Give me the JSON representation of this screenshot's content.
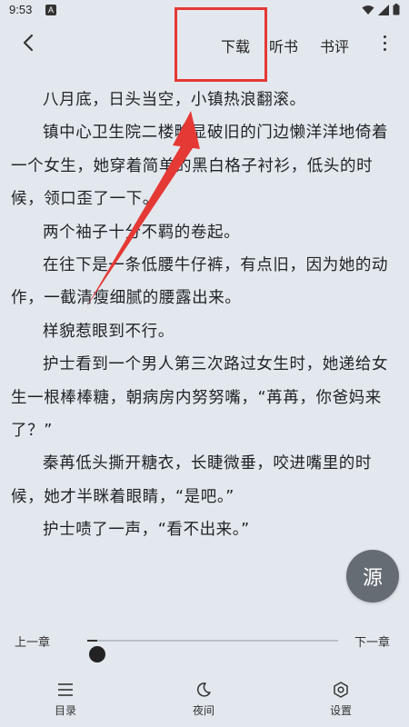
{
  "status_bar": {
    "time": "9:53",
    "indicator": "A"
  },
  "top_bar": {
    "back_icon": "chevron-left-icon",
    "tabs": [
      {
        "label": "下载"
      },
      {
        "label": "听书"
      },
      {
        "label": "书评"
      }
    ],
    "more_icon": "more-vertical-icon"
  },
  "reader": {
    "paragraphs": [
      "八月底，日头当空，小镇热浪翻滚。",
      "镇中心卫生院二楼略显破旧的门边懒洋洋地倚着一个女生，她穿着简单的黑白格子衬衫，低头的时候，领口歪了一下。",
      "两个袖子十分不羁的卷起。",
      "在往下是一条低腰牛仔裤，有点旧，因为她的动作，一截清瘦细腻的腰露出来。",
      "样貌惹眼到不行。",
      "护士看到一个男人第三次路过女生时，她递给女生一根棒棒糖，朝病房内努努嘴，“苒苒，你爸妈来了？”",
      "秦苒低头撕开糖衣，长睫微垂，咬进嘴里的时候，她才半眯着眼睛，“是吧。”",
      "护士啧了一声，“看不出来。”"
    ]
  },
  "source_button": {
    "label": "源"
  },
  "progress": {
    "prev_label": "上一章",
    "next_label": "下一章",
    "value_fraction": 0.04
  },
  "bottom_bar": {
    "items": [
      {
        "label": "目录",
        "icon": "list-icon"
      },
      {
        "label": "夜间",
        "icon": "moon-icon"
      },
      {
        "label": "设置",
        "icon": "settings-icon"
      }
    ]
  },
  "annotation": {
    "highlight_color": "#e53935"
  }
}
